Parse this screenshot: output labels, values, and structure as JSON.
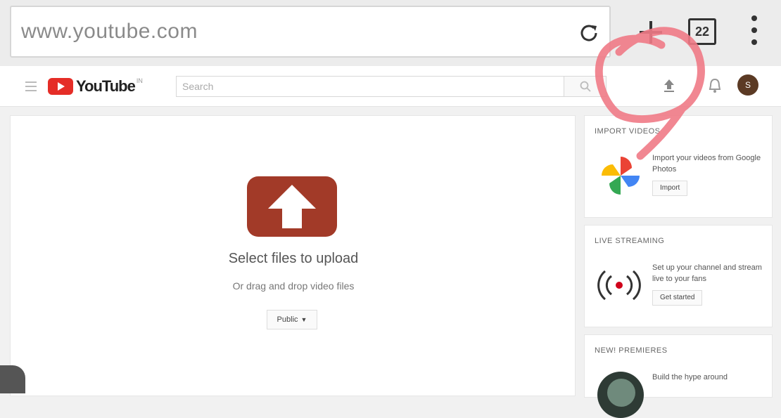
{
  "browser": {
    "url": "www.youtube.com",
    "tab_count": "22"
  },
  "masthead": {
    "logo_text": "YouTube",
    "logo_sup": "IN",
    "search_placeholder": "Search",
    "avatar_initial": "S"
  },
  "upload": {
    "title": "Select files to upload",
    "subtitle": "Or drag and drop video files",
    "privacy": "Public"
  },
  "cards": [
    {
      "title": "IMPORT VIDEOS",
      "text": "Import your videos from Google Photos",
      "button": "Import"
    },
    {
      "title": "LIVE STREAMING",
      "text": "Set up your channel and stream live to your fans",
      "button": "Get started"
    },
    {
      "title": "NEW! PREMIERES",
      "text": "Build the hype around"
    }
  ],
  "colors": {
    "youtube_red": "#e52d27",
    "upload_brown": "#a23a28",
    "annotation_pink": "#f07a86",
    "live_red": "#d0021b"
  },
  "icons": {
    "reload": "reload-icon",
    "new_tab": "plus-icon",
    "menu": "kebab-menu-icon",
    "upload": "upload-icon",
    "notifications": "bell-icon",
    "search": "search-icon",
    "photos": "google-photos-pinwheel-icon",
    "live": "live-broadcast-icon"
  }
}
